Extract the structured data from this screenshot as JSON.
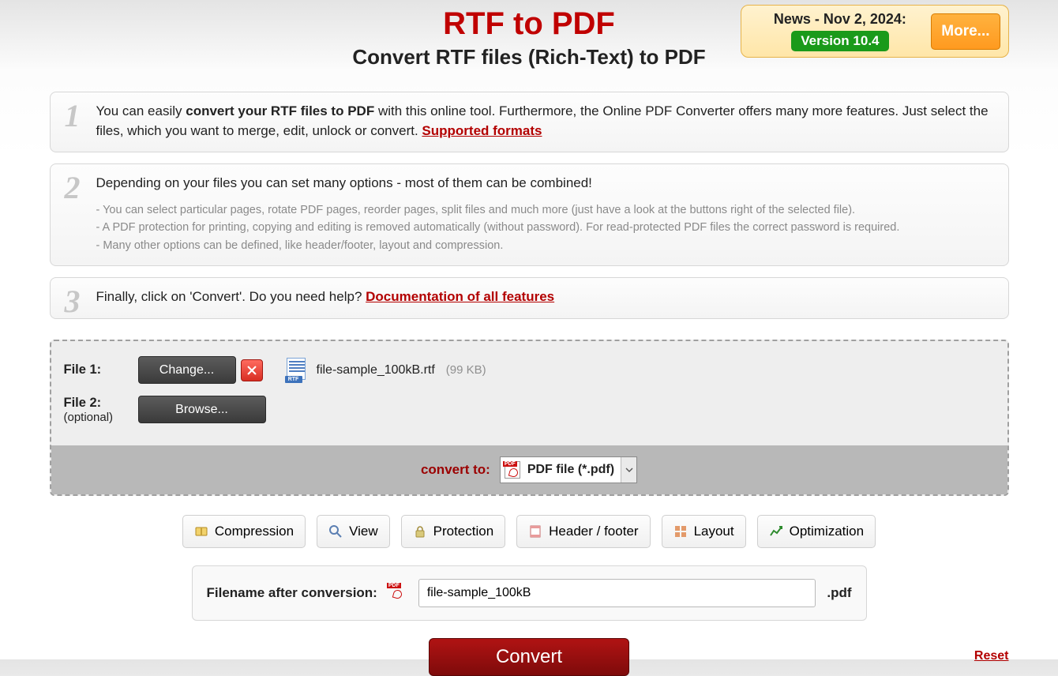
{
  "header": {
    "title": "RTF to PDF",
    "subtitle": "Convert RTF files (Rich-Text) to PDF"
  },
  "news": {
    "title": "News - Nov 2, 2024:",
    "version": "Version 10.4",
    "more": "More..."
  },
  "step1": {
    "num": "1",
    "pre": "You can easily ",
    "bold": "convert your RTF files to PDF",
    "post": " with this online tool. Furthermore, the Online PDF Converter offers many more features. Just select the files, which you want to merge, edit, unlock or convert. ",
    "link": "Supported formats"
  },
  "step2": {
    "num": "2",
    "main": "Depending on your files you can set many options - most of them can be combined!",
    "b1": "- You can select particular pages, rotate PDF pages, reorder pages, split files and much more (just have a look at the buttons right of the selected file).",
    "b2": "- A PDF protection for printing, copying and editing is removed automatically (without password). For read-protected PDF files the correct password is required.",
    "b3": "- Many other options can be defined, like header/footer, layout and compression."
  },
  "step3": {
    "num": "3",
    "pre": "Finally, click on 'Convert'. Do you need help? ",
    "link": "Documentation of all features"
  },
  "files": {
    "row1": {
      "label": "File 1:",
      "change": "Change...",
      "name": "file-sample_100kB.rtf",
      "size": "(99 KB)",
      "icon_tag": "RTF"
    },
    "row2": {
      "label": "File 2:",
      "optional": "(optional)",
      "browse": "Browse..."
    }
  },
  "convert_to": {
    "label": "convert to:",
    "value": "PDF file (*.pdf)"
  },
  "options": {
    "compression": "Compression",
    "view": "View",
    "protection": "Protection",
    "header_footer": "Header / footer",
    "layout": "Layout",
    "optimization": "Optimization"
  },
  "filename": {
    "label": "Filename after conversion:",
    "value": "file-sample_100kB",
    "ext": ".pdf"
  },
  "footer": {
    "convert": "Convert",
    "reset": "Reset"
  }
}
